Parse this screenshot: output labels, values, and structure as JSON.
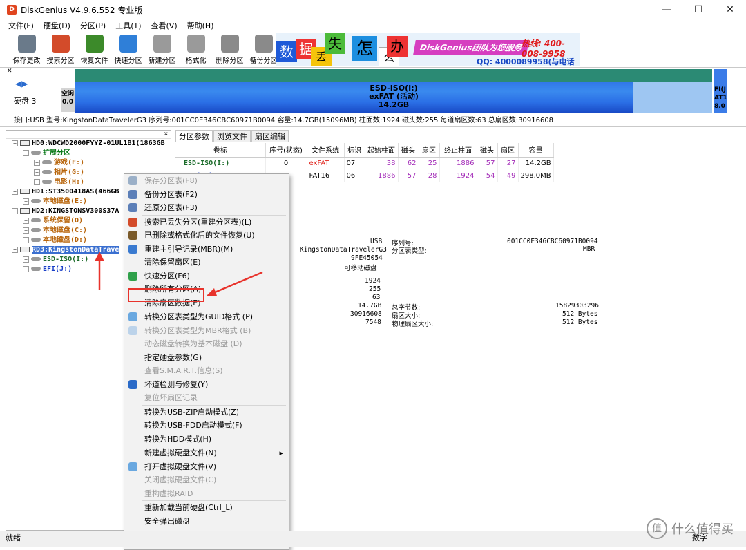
{
  "window": {
    "title": "DiskGenius V4.9.6.552 专业版",
    "app_icon_letter": "D"
  },
  "menubar": [
    "文件(F)",
    "硬盘(D)",
    "分区(P)",
    "工具(T)",
    "查看(V)",
    "帮助(H)"
  ],
  "toolbar": [
    {
      "label": "保存更改",
      "icon": "save-icon",
      "color": "#6a7a8a"
    },
    {
      "label": "搜索分区",
      "icon": "search-icon",
      "color": "#d34b2a"
    },
    {
      "label": "恢复文件",
      "icon": "recover-icon",
      "color": "#3c8a2a"
    },
    {
      "label": "快速分区",
      "icon": "quick-partition-icon",
      "color": "#2f7fd8"
    },
    {
      "label": "新建分区",
      "icon": "new-partition-icon",
      "color": "#9a9a9a"
    },
    {
      "label": "格式化",
      "icon": "format-icon",
      "color": "#9a9a9a"
    },
    {
      "label": "删除分区",
      "icon": "delete-partition-icon",
      "color": "#8a8a8a"
    },
    {
      "label": "备份分区",
      "icon": "backup-partition-icon",
      "color": "#8a8a8a"
    }
  ],
  "ad": {
    "chars": [
      "数",
      "据",
      "丢",
      "失",
      "怎",
      "么",
      "办"
    ],
    "slogan": "DiskGenius团队为您服务",
    "phone": "热线: 400-008-9958",
    "qq": "QQ: 4000089958(与电话同号)"
  },
  "diskbar": {
    "disk_label": "硬盘 3",
    "free_seg": "空闲\n0.0",
    "main_seg": {
      "name": "ESD-ISO(I:)",
      "fs": "exFAT (活动)",
      "size": "14.2GB"
    },
    "end_seg": "FI(J\nAT1\n8.0"
  },
  "infobar": "接口:USB  型号:KingstonDataTravelerG3  序列号:001CC0E346CBC60971B0094  容量:14.7GB(15096MB)  柱面数:1924  磁头数:255  每道扇区数:63  总扇区数:30916608",
  "tree": [
    {
      "label": "HD0:WDCWD2000FYYZ-01UL1B1(1863GB",
      "level": 0,
      "type": "disk",
      "exp": "−"
    },
    {
      "label": "扩展分区",
      "level": 1,
      "type": "part",
      "color": "c-green",
      "exp": "−"
    },
    {
      "label": "游戏(F:)",
      "level": 2,
      "type": "part",
      "color": "c-orange",
      "exp": "+"
    },
    {
      "label": "相片(G:)",
      "level": 2,
      "type": "part",
      "color": "c-orange",
      "exp": "+"
    },
    {
      "label": "电影(H:)",
      "level": 2,
      "type": "part",
      "color": "c-orange",
      "exp": "+"
    },
    {
      "label": "HD1:ST3500418AS(466GB",
      "level": 0,
      "type": "disk",
      "exp": "−"
    },
    {
      "label": "本地磁盘(E:)",
      "level": 1,
      "type": "part",
      "color": "c-orange",
      "exp": "+"
    },
    {
      "label": "HD2:KINGSTONSV300S37A",
      "level": 0,
      "type": "disk",
      "exp": "−"
    },
    {
      "label": "系统保留(O)",
      "level": 1,
      "type": "part",
      "color": "c-orange",
      "exp": "+"
    },
    {
      "label": "本地磁盘(C:)",
      "level": 1,
      "type": "part",
      "color": "c-orange",
      "exp": "+"
    },
    {
      "label": "本地磁盘(D:)",
      "level": 1,
      "type": "part",
      "color": "c-orange",
      "exp": "+"
    },
    {
      "label": "RD3:KingstonDataTrave",
      "level": 0,
      "type": "disk",
      "exp": "−",
      "selected": true
    },
    {
      "label": "ESD-ISO(I:)",
      "level": 1,
      "type": "part",
      "color": "c-darkgreen",
      "exp": "+"
    },
    {
      "label": "EFI(J:)",
      "level": 1,
      "type": "part",
      "color": "c-blue",
      "exp": "+"
    }
  ],
  "tabs": [
    "分区参数",
    "浏览文件",
    "扇区编辑"
  ],
  "grid": {
    "headers": [
      "卷标",
      "序号(状态)",
      "文件系统",
      "标识",
      "起始柱面",
      "磁头",
      "扇区",
      "终止柱面",
      "磁头",
      "扇区",
      "容量"
    ],
    "rows": [
      [
        "ESD-ISO(I:)",
        "0",
        "exFAT",
        "07",
        "38",
        "62",
        "25",
        "1886",
        "57",
        "27",
        "14.2GB"
      ],
      [
        "EFI(J:)",
        "1",
        "FAT16",
        "06",
        "1886",
        "57",
        "28",
        "1924",
        "54",
        "49",
        "298.0MB"
      ]
    ]
  },
  "detail": {
    "iface": "USB",
    "model": "KingstonDataTravelerG3",
    "sig": "9FE45054",
    "type": "可移动磁盘",
    "sn_label": "序列号:",
    "sn": "001CC0E346CBC60971B0094",
    "ptype_label": "分区表类型:",
    "ptype": "MBR",
    "cyl": "1924",
    "heads": "255",
    "spt": "63",
    "cap": "14.7GB",
    "total_bytes_label": "总字节数:",
    "total_bytes": "15829303296",
    "sectors": "30916608",
    "sector_size_label": "扇区大小:",
    "sector_size": "512 Bytes",
    "extra": "7548",
    "phys_sector_label": "物理扇区大小:",
    "phys_sector": "512 Bytes"
  },
  "context_menu": [
    {
      "label": "保存分区表(F8)",
      "disabled": true,
      "icon": "save-icon",
      "color": "#9bb0c8"
    },
    {
      "label": "备份分区表(F2)",
      "disabled": false,
      "icon": "backup-table-icon",
      "color": "#5c7fb8"
    },
    {
      "label": "还原分区表(F3)",
      "disabled": false,
      "icon": "restore-table-icon",
      "color": "#5c7fb8"
    },
    {
      "sep": true
    },
    {
      "label": "搜索已丢失分区(重建分区表)(L)",
      "disabled": false,
      "icon": "search-icon",
      "color": "#d34b2a"
    },
    {
      "label": "已删除或格式化后的文件恢复(U)",
      "disabled": false,
      "icon": "recover-icon",
      "color": "#7a5a2a"
    },
    {
      "label": "重建主引导记录(MBR)(M)",
      "disabled": false,
      "icon": "mbr-icon",
      "color": "#3a7ad0"
    },
    {
      "label": "清除保留扇区(E)",
      "disabled": false,
      "icon": "",
      "color": ""
    },
    {
      "label": "快速分区(F6)",
      "disabled": false,
      "icon": "quick-partition-icon",
      "color": "#2fa04a"
    },
    {
      "label": "删除所有分区(A)",
      "disabled": false,
      "icon": "",
      "color": ""
    },
    {
      "label": "清除扇区数据(E)",
      "disabled": false,
      "icon": "",
      "color": ""
    },
    {
      "sep": true
    },
    {
      "label": "转换分区表类型为GUID格式 (P)",
      "disabled": false,
      "icon": "convert-icon",
      "color": "#6aa8e0"
    },
    {
      "label": "转换分区表类型为MBR格式 (B)",
      "disabled": true,
      "icon": "convert-icon",
      "color": "#bcd3ea"
    },
    {
      "label": "动态磁盘转换为基本磁盘 (D)",
      "disabled": true,
      "icon": "",
      "color": ""
    },
    {
      "label": "指定硬盘参数(G)",
      "disabled": false,
      "icon": "",
      "color": ""
    },
    {
      "label": "查看S.M.A.R.T.信息(S)",
      "disabled": true,
      "icon": "",
      "color": ""
    },
    {
      "label": "坏道检测与修复(Y)",
      "disabled": false,
      "icon": "repair-icon",
      "color": "#2a6ac8"
    },
    {
      "label": "复位坏扇区记录",
      "disabled": true,
      "icon": "",
      "color": ""
    },
    {
      "sep": true
    },
    {
      "label": "转换为USB-ZIP启动模式(Z)",
      "disabled": false,
      "icon": "",
      "color": ""
    },
    {
      "label": "转换为USB-FDD启动模式(F)",
      "disabled": false,
      "icon": "",
      "color": ""
    },
    {
      "label": "转换为HDD模式(H)",
      "disabled": false,
      "icon": "",
      "color": ""
    },
    {
      "sep": true
    },
    {
      "label": "新建虚拟硬盘文件(N)",
      "disabled": false,
      "icon": "",
      "color": "",
      "submenu": true
    },
    {
      "label": "打开虚拟硬盘文件(V)",
      "disabled": false,
      "icon": "virtual-disk-icon",
      "color": "#6aa8e0"
    },
    {
      "label": "关闭虚拟硬盘文件(C)",
      "disabled": true,
      "icon": "",
      "color": ""
    },
    {
      "label": "重构虚拟RAID",
      "disabled": true,
      "icon": "",
      "color": ""
    },
    {
      "sep": true
    },
    {
      "label": "重新加载当前硬盘(Ctrl_L)",
      "disabled": false,
      "icon": "",
      "color": ""
    },
    {
      "label": "安全弹出磁盘",
      "disabled": false,
      "icon": "",
      "color": ""
    }
  ],
  "statusbar": {
    "left": "就绪",
    "right": "数字"
  },
  "watermark": {
    "symbol": "值",
    "text": "什么值得买"
  }
}
